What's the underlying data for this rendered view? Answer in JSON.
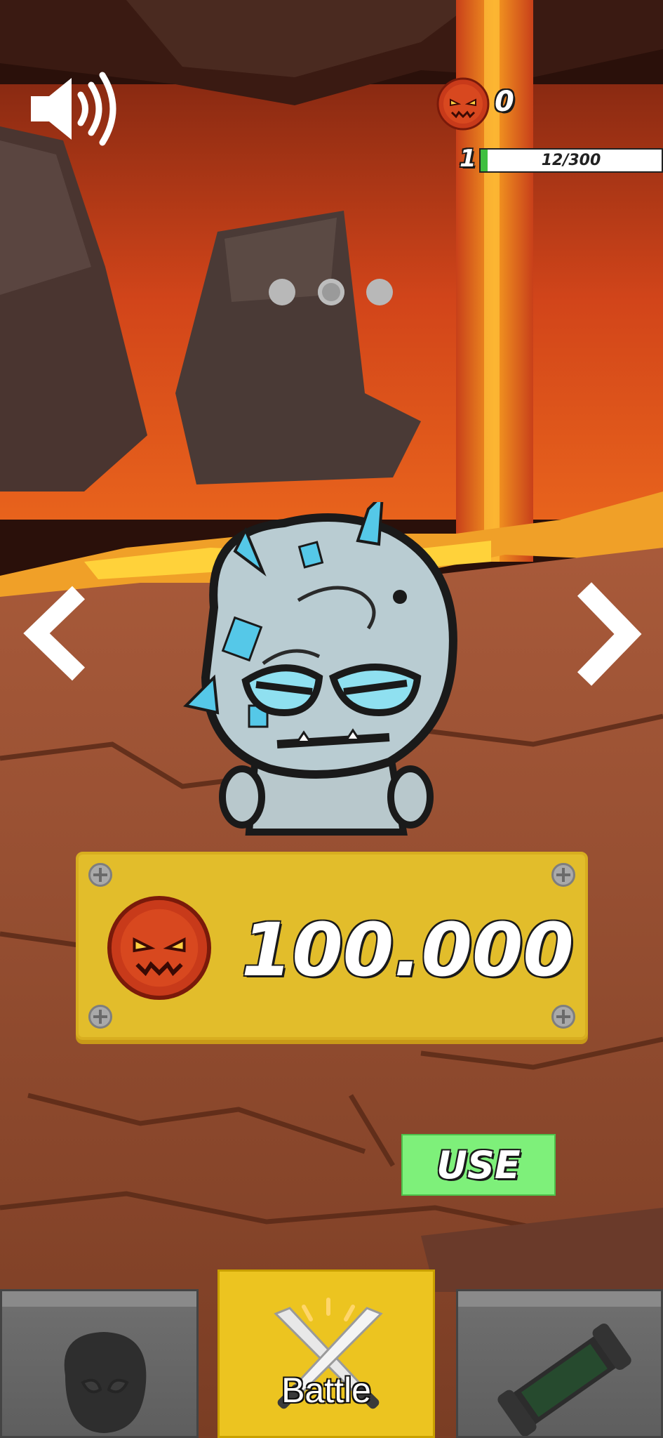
{
  "hud": {
    "coins": "0",
    "level": "1",
    "xp_text": "12/300",
    "xp_progress": 0.04,
    "sound_icon": "speaker-icon",
    "coin_icon": "demon-coin-icon"
  },
  "carousel": {
    "page_count": 3,
    "active_index": 1
  },
  "character": {
    "price": "100.000",
    "price_icon": "demon-coin-icon"
  },
  "actions": {
    "use_label": "USE"
  },
  "bottom_nav": {
    "tabs": [
      {
        "id": "characters",
        "icon": "character-head-icon"
      },
      {
        "id": "battle",
        "label": "Battle",
        "icon": "crossed-swords-icon"
      },
      {
        "id": "weapons",
        "icon": "cannon-icon"
      }
    ]
  },
  "colors": {
    "panel": "#e2bd2b",
    "use_button": "#7ef07a",
    "battle_tab": "#ecc420",
    "xp_fill": "#3fbf3f"
  }
}
